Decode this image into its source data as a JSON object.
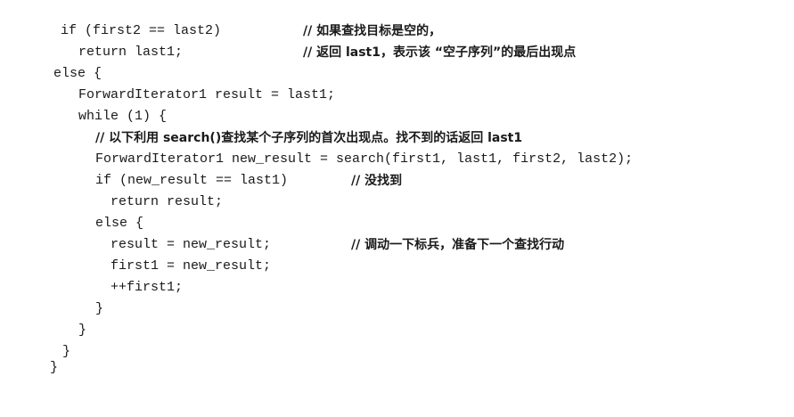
{
  "lines": [
    {
      "code": "if (first2 == last2)",
      "comment": "// 如果查找目标是空的，"
    },
    {
      "code": "return last1;",
      "comment": "// 返回 last1，表示该 “空子序列”的最后出现点"
    },
    {
      "code": "else {"
    },
    {
      "code": "ForwardIterator1 result = last1;"
    },
    {
      "code": "while (1) {"
    },
    {
      "comment": "// 以下利用 search()查找某个子序列的首次出现点。找不到的话返回 last1"
    },
    {
      "code": "ForwardIterator1 new_result = search(first1, last1, first2, last2);"
    },
    {
      "code": "if (new_result == last1)",
      "comment": "// 没找到"
    },
    {
      "code": "return result;"
    },
    {
      "code": "else {"
    },
    {
      "code": "result = new_result;",
      "comment": "// 调动一下标兵，准备下一个查找行动"
    },
    {
      "code": "first1 = new_result;"
    },
    {
      "code": "++first1;"
    },
    {
      "code": "}"
    },
    {
      "code": "}"
    },
    {
      "code": "}"
    },
    {
      "code": "}"
    }
  ]
}
